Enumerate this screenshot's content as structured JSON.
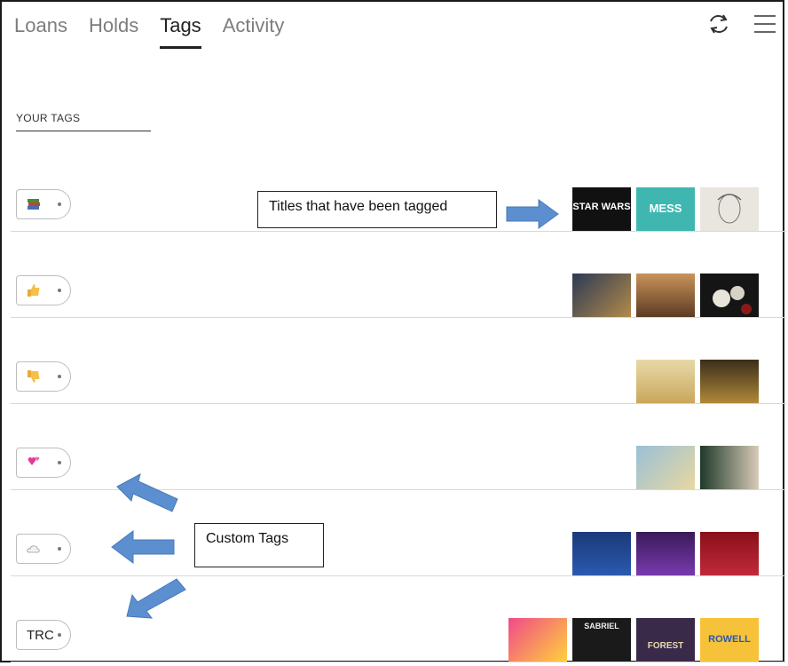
{
  "nav": {
    "tabs": [
      {
        "label": "Loans"
      },
      {
        "label": "Holds"
      },
      {
        "label": "Tags"
      },
      {
        "label": "Activity"
      }
    ],
    "active_tab": "Tags",
    "refresh_icon": "refresh-icon",
    "menu_icon": "hamburger-menu-icon"
  },
  "section": {
    "label": "YOUR TAGS"
  },
  "rows": [
    {
      "tag_icon": "books-emoji",
      "tag_text": "",
      "covers": [
        "Star Wars",
        "Mess Mexico",
        "portrait sketch"
      ]
    },
    {
      "tag_icon": "thumbs-up-emoji",
      "tag_text": "",
      "covers": [
        "painting woman",
        "Northanger",
        "white roses"
      ]
    },
    {
      "tag_icon": "thumbs-down-emoji",
      "tag_text": "",
      "covers": [
        "A Tale of Two Cities",
        "Crime and Punishment"
      ]
    },
    {
      "tag_icon": "hearts-emoji",
      "tag_text": "",
      "covers": [
        "painted scene",
        "lady in hat"
      ]
    },
    {
      "tag_icon": "cloud-emoji",
      "tag_text": "",
      "covers": [
        "The Infernal Tragedy",
        "The Exquisite Marriage",
        "The Bible Beautiful"
      ]
    },
    {
      "tag_icon": "",
      "tag_text": "TRC",
      "covers": [
        "colorful cover",
        "Sabriel",
        "Daughter of the Forest",
        "Rainbow Rowell"
      ]
    }
  ],
  "annotations": {
    "titles_callout": "Titles that have been tagged",
    "custom_callout": "Custom Tags"
  },
  "cover_texts": {
    "star_wars": "STAR WARS",
    "mess": "MESS",
    "sabriel": "SABRIEL",
    "forest": "FOREST",
    "rowell": "ROWELL"
  },
  "colors": {
    "accent_arrow": "#5b8fd0",
    "active_tab": "#222222",
    "inactive_tab": "#7d7d7d"
  }
}
